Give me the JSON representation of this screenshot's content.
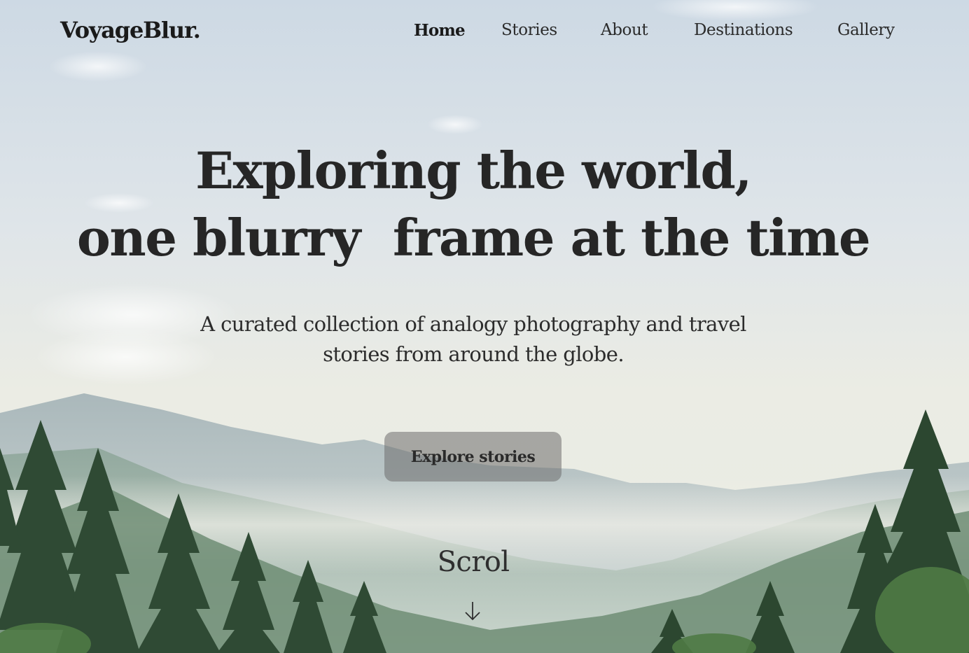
{
  "brand": {
    "logo": "VoyageBlur."
  },
  "nav": {
    "items": [
      {
        "label": "Home",
        "active": true
      },
      {
        "label": "Stories"
      },
      {
        "label": "About"
      },
      {
        "label": "Destinations"
      },
      {
        "label": "Gallery"
      }
    ]
  },
  "hero": {
    "headline_line1": "Exploring the world,",
    "headline_line2": "one blurry  frame at the time",
    "subtitle": "A curated collection of analogy photography and travel stories from around the globe.",
    "cta_label": "Explore stories",
    "scroll_label": "Scrol",
    "scroll_icon": "arrow-down-icon"
  },
  "colors": {
    "text": "#262626",
    "button_bg": "#8a8a8a",
    "sky": "#dfe6ea",
    "forest": "#2f4a34"
  }
}
